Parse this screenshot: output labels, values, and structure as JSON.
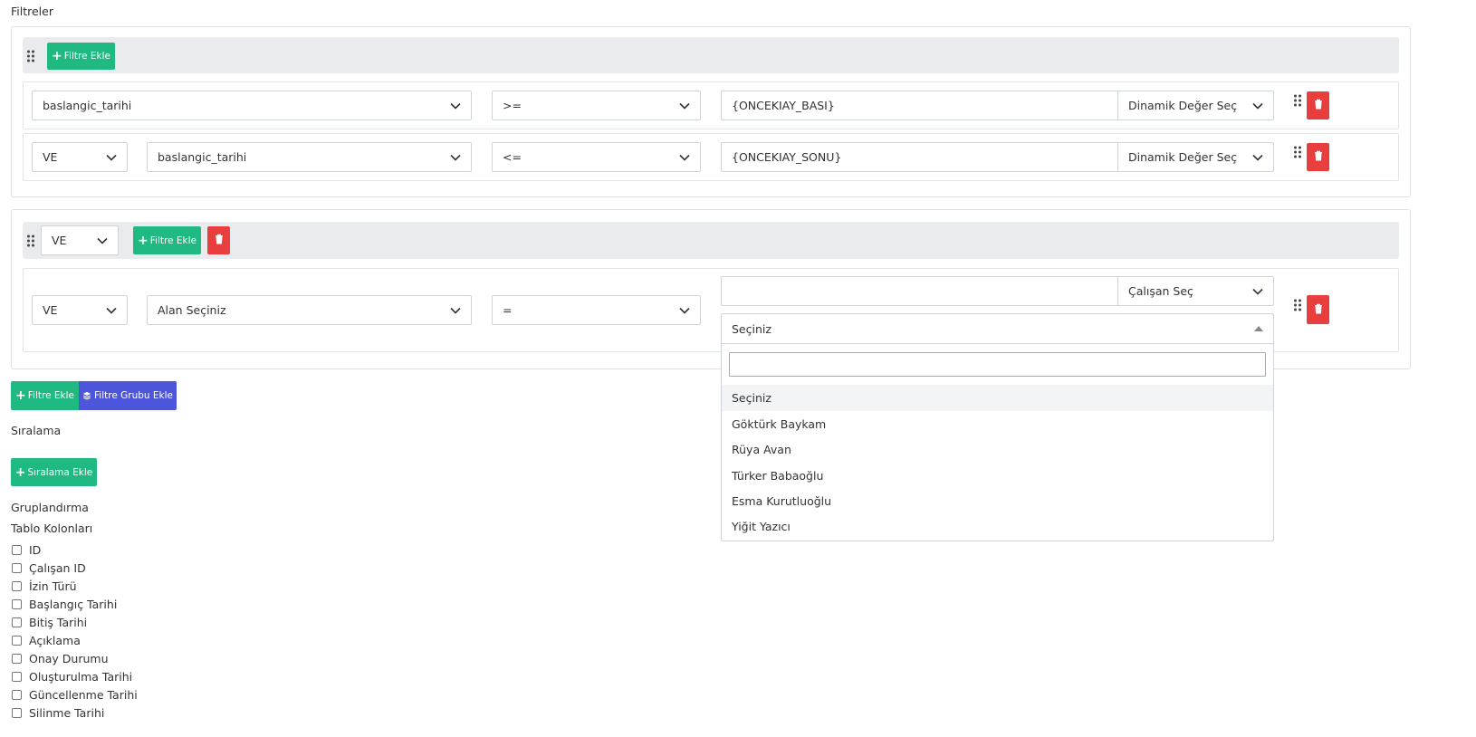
{
  "sections": {
    "filters_title": "Filtreler",
    "sorting_title": "Sıralama",
    "grouping_title": "Gruplandırma",
    "columns_title": "Tablo Kolonları"
  },
  "group1": {
    "add_filter_label": "Filtre Ekle",
    "rows": [
      {
        "field": "baslangic_tarihi",
        "operator": ">=",
        "value": "{ONCEKIAY_BASI}",
        "value_type": "Dinamik Değer Seç"
      },
      {
        "connector": "VE",
        "field": "baslangic_tarihi",
        "operator": "<=",
        "value": "{ONCEKIAY_SONU}",
        "value_type": "Dinamik Değer Seç"
      }
    ]
  },
  "group2": {
    "connector": "VE",
    "add_filter_label": "Filtre Ekle",
    "row": {
      "connector": "VE",
      "field": "Alan Seçiniz",
      "operator": "=",
      "value": "",
      "value_type": "Çalışan Seç",
      "employee_select": {
        "selected": "Seçiniz",
        "search_value": "",
        "options": [
          "Seçiniz",
          "Göktürk Baykam",
          "Rüya Avan",
          "Türker Babaoğlu",
          "Esma Kurutluoğlu",
          "Yiğit Yazıcı"
        ]
      }
    }
  },
  "actions": {
    "add_filter_label": "Filtre Ekle",
    "add_filter_group_label": "Filtre Grubu Ekle",
    "add_sort_label": "Sıralama Ekle"
  },
  "columns": [
    "ID",
    "Çalışan ID",
    "İzin Türü",
    "Başlangıç Tarihi",
    "Bitiş Tarihi",
    "Açıklama",
    "Onay Durumu",
    "Oluşturulma Tarihi",
    "Güncellenme Tarihi",
    "Silinme Tarihi"
  ],
  "colors": {
    "green": "#20b981",
    "blue": "#4d55db",
    "red": "#e83e3e",
    "toolbar_bg": "#e9ebee"
  }
}
